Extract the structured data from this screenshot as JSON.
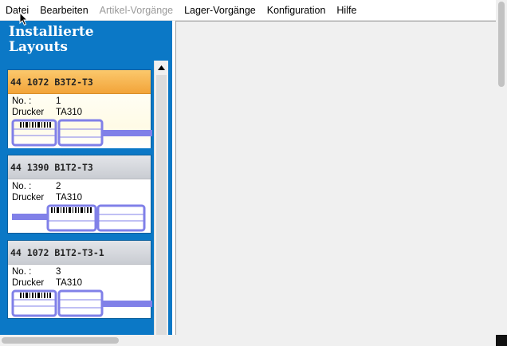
{
  "menu": {
    "items": [
      {
        "label": "Datei",
        "disabled": false
      },
      {
        "label": "Bearbeiten",
        "disabled": false
      },
      {
        "label": "Artikel-Vorgänge",
        "disabled": true
      },
      {
        "label": "Lager-Vorgänge",
        "disabled": false
      },
      {
        "label": "Konfiguration",
        "disabled": false
      },
      {
        "label": "Hilfe",
        "disabled": false
      }
    ]
  },
  "panel": {
    "title_line1": "Installierte",
    "title_line2": "Layouts"
  },
  "layouts": [
    {
      "name": "44 1072 B3T2-T3",
      "no_label": "No. :",
      "no_value": "1",
      "printer_label": "Drucker",
      "printer_value": "TA310",
      "selected": true
    },
    {
      "name": "44 1390 B1T2-T3",
      "no_label": "No. :",
      "no_value": "2",
      "printer_label": "Drucker",
      "printer_value": "TA310",
      "selected": false
    },
    {
      "name": "44 1072 B1T2-T3-1",
      "no_label": "No. :",
      "no_value": "3",
      "printer_label": "Drucker",
      "printer_value": "TA310",
      "selected": false
    }
  ],
  "colors": {
    "panel_blue": "#0b78c6",
    "selected_header": "#f2a43a",
    "label_stroke": "#8080e8"
  }
}
